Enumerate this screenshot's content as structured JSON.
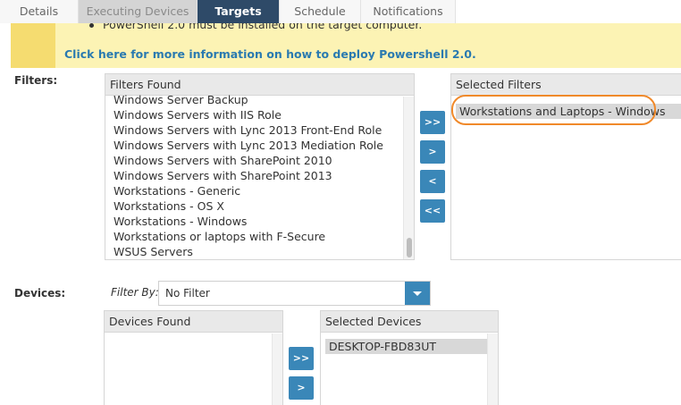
{
  "tabs": [
    {
      "label": "Details",
      "state": "normal"
    },
    {
      "label": "Executing Devices",
      "state": "disabled"
    },
    {
      "label": "Targets",
      "state": "active"
    },
    {
      "label": "Schedule",
      "state": "normal"
    },
    {
      "label": "Notifications",
      "state": "normal"
    }
  ],
  "notice": {
    "bullet_text": "PowerShell 2.0 must be installed on the target computer.",
    "link_text": "Click here for more information on how to deploy Powershell 2.0."
  },
  "filters": {
    "label": "Filters:",
    "found_header": "Filters Found",
    "found_items": [
      "Windows Server Backup",
      "Windows Servers with IIS Role",
      "Windows Servers with Lync 2013 Front-End Role",
      "Windows Servers with Lync 2013 Mediation Role",
      "Windows Servers with SharePoint 2010",
      "Windows Servers with SharePoint 2013",
      "Workstations - Generic",
      "Workstations - OS X",
      "Workstations - Windows",
      "Workstations or laptops with F-Secure",
      "WSUS Servers"
    ],
    "selected_header": "Selected Filters",
    "selected_items": [
      "Workstations and Laptops - Windows"
    ],
    "buttons": {
      "add_all": ">>",
      "add": ">",
      "remove": "<",
      "remove_all": "<<"
    }
  },
  "devices": {
    "label": "Devices:",
    "filter_by_label": "Filter By:",
    "filter_value": "No Filter",
    "found_header": "Devices Found",
    "selected_header": "Selected Devices",
    "selected_items": [
      "DESKTOP-FBD83UT"
    ],
    "buttons": {
      "add_all": ">>",
      "add": ">"
    }
  },
  "colors": {
    "accent": "#3a87b8",
    "active_tab": "#2e4a68",
    "notice_bg": "#fcf3b4",
    "highlight_ring": "#f0892a"
  }
}
